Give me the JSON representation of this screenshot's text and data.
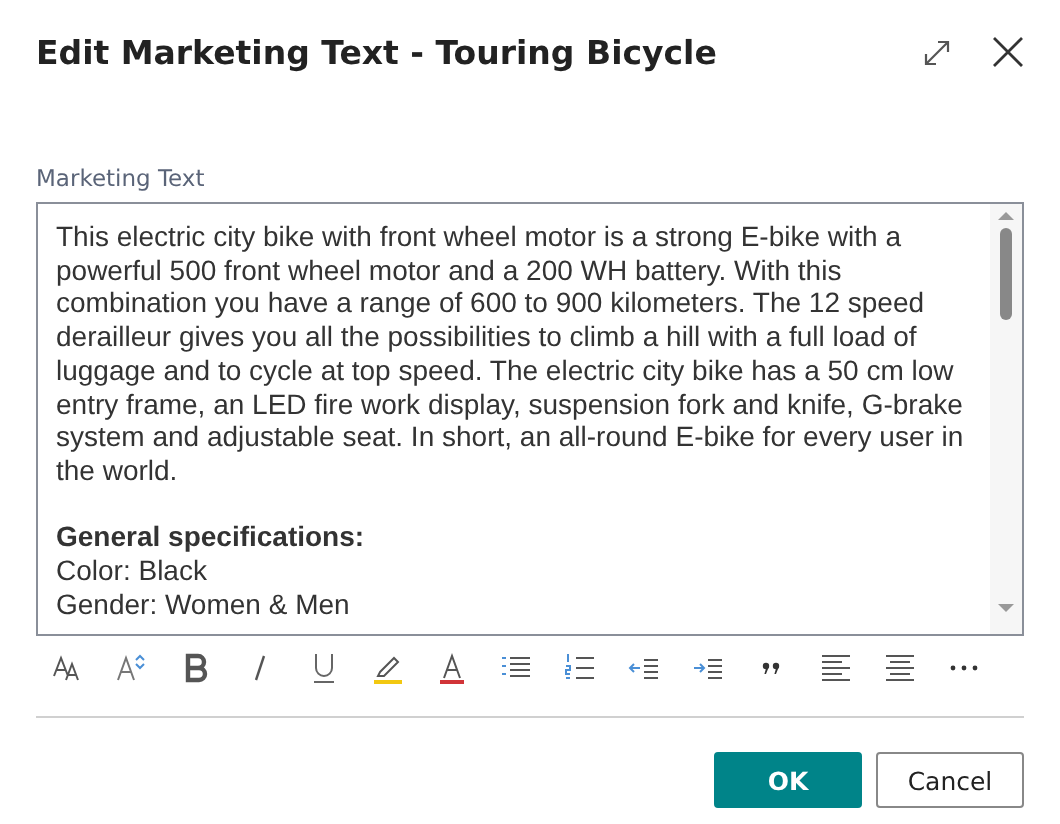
{
  "dialog": {
    "title": "Edit Marketing Text - Touring Bicycle"
  },
  "field": {
    "label": "Marketing Text",
    "content": [
      {
        "kind": "body",
        "text": "This electric city bike with front wheel motor is a strong E-bike with a powerful 500 front wheel motor and a 200 WH battery. With this combination you have a range of 600 to 900 kilometers. The 12 speed derailleur gives you all the possibilities to climb a hill with a full load of luggage and to cycle at top speed. The electric city bike has a 50 cm low entry frame, an LED fire work display, suspension fork and knife, G-brake system and adjustable seat. In short, an all-round E-bike for every user in the world."
      },
      {
        "kind": "heading",
        "text": "General specifications:"
      },
      {
        "kind": "line",
        "text": "Color: Black"
      },
      {
        "kind": "line",
        "text": "Gender: Women & Men"
      }
    ]
  },
  "buttons": [
    {
      "label": "OK",
      "kind": "primary"
    },
    {
      "label": "Cancel",
      "kind": "secondary"
    }
  ]
}
